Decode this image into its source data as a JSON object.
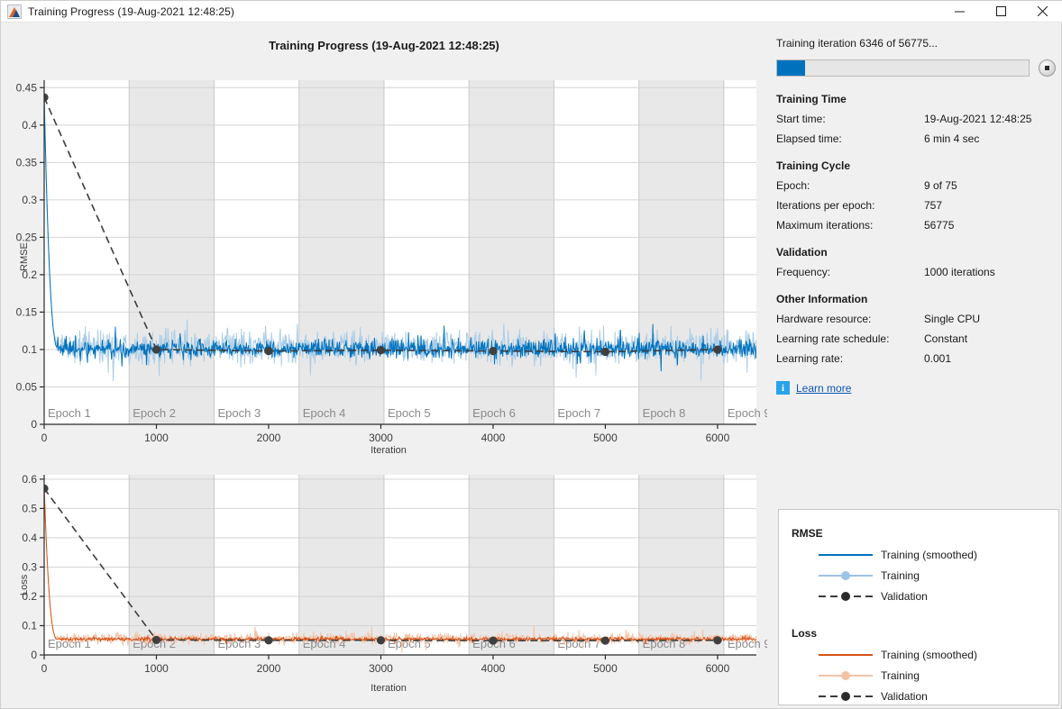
{
  "window": {
    "title": "Training Progress (19-Aug-2021 12:48:25)",
    "app_icon": "matlab-icon",
    "minimize_label": "Minimize",
    "maximize_label": "Maximize",
    "close_label": "Close"
  },
  "chart_title": "Training Progress (19-Aug-2021 12:48:25)",
  "status": {
    "text": "Training iteration 6346 of 56775...",
    "progress_percent": 11.2,
    "stop_button_label": "Stop",
    "progress_color": "#0072bd"
  },
  "sections": [
    {
      "heading": "Training Time",
      "rows": [
        {
          "key": "Start time:",
          "value": "19-Aug-2021 12:48:25"
        },
        {
          "key": "Elapsed time:",
          "value": "6 min 4 sec"
        }
      ]
    },
    {
      "heading": "Training Cycle",
      "rows": [
        {
          "key": "Epoch:",
          "value": "9 of 75"
        },
        {
          "key": "Iterations per epoch:",
          "value": "757"
        },
        {
          "key": "Maximum iterations:",
          "value": "56775"
        }
      ]
    },
    {
      "heading": "Validation",
      "rows": [
        {
          "key": "Frequency:",
          "value": "1000 iterations"
        }
      ]
    },
    {
      "heading": "Other Information",
      "rows": [
        {
          "key": "Hardware resource:",
          "value": "Single CPU"
        },
        {
          "key": "Learning rate schedule:",
          "value": "Constant"
        },
        {
          "key": "Learning rate:",
          "value": "0.001"
        }
      ]
    }
  ],
  "learn_more": {
    "label": "Learn more",
    "icon": "info-icon"
  },
  "legend": {
    "groups": [
      {
        "title": "RMSE",
        "items": [
          {
            "label": "Training (smoothed)",
            "style": "solid",
            "color": "#0072bd",
            "marker": false
          },
          {
            "label": "Training",
            "style": "solid",
            "color": "#9dc3e6",
            "marker": true
          },
          {
            "label": "Validation",
            "style": "dashed",
            "color": "#3c3c3c",
            "marker": true
          }
        ]
      },
      {
        "title": "Loss",
        "items": [
          {
            "label": "Training (smoothed)",
            "style": "solid",
            "color": "#d95319",
            "marker": false
          },
          {
            "label": "Training",
            "style": "solid",
            "color": "#f3c3a8",
            "marker": true
          },
          {
            "label": "Validation",
            "style": "dashed",
            "color": "#3c3c3c",
            "marker": true
          }
        ]
      }
    ]
  },
  "chart_data": [
    {
      "id": "rmse",
      "type": "line",
      "title": "Training Progress (19-Aug-2021 12:48:25)",
      "xlabel": "Iteration",
      "ylabel": "RMSE",
      "xlim": [
        0,
        6346
      ],
      "ylim": [
        0,
        0.46
      ],
      "xticks": [
        0,
        1000,
        2000,
        3000,
        4000,
        5000,
        6000
      ],
      "yticks": [
        0,
        0.05,
        0.1,
        0.15,
        0.2,
        0.25,
        0.3,
        0.35,
        0.4,
        0.45
      ],
      "grid": true,
      "epoch_bands": {
        "iterations_per_epoch": 757,
        "labels": [
          "Epoch 1",
          "Epoch 2",
          "Epoch 3",
          "Epoch 4",
          "Epoch 5",
          "Epoch 6",
          "Epoch 7",
          "Epoch 8",
          "Epoch 9"
        ],
        "shade_color": "#e8e8e8"
      },
      "series": [
        {
          "name": "Training",
          "color": "#a8cce8",
          "style": "solid",
          "noise_amplitude": 0.032,
          "start_value": 0.44,
          "plateau_value": 0.103,
          "decay_iterations": 130
        },
        {
          "name": "Training (smoothed)",
          "color": "#0072bd",
          "style": "solid",
          "noise_amplitude": 0.017,
          "start_value": 0.44,
          "plateau_value": 0.101,
          "decay_iterations": 130
        },
        {
          "name": "Validation",
          "color": "#3c3c3c",
          "style": "dashed",
          "x": [
            0,
            1000,
            2000,
            3000,
            4000,
            5000,
            6000
          ],
          "y": [
            0.437,
            0.1,
            0.098,
            0.099,
            0.098,
            0.097,
            0.1
          ]
        }
      ]
    },
    {
      "id": "loss",
      "type": "line",
      "xlabel": "Iteration",
      "ylabel": "Loss",
      "xlim": [
        0,
        6346
      ],
      "ylim": [
        0,
        0.615
      ],
      "xticks": [
        0,
        1000,
        2000,
        3000,
        4000,
        5000,
        6000
      ],
      "yticks": [
        0,
        0.1,
        0.2,
        0.3,
        0.4,
        0.5,
        0.6
      ],
      "grid": true,
      "epoch_bands": {
        "iterations_per_epoch": 757,
        "labels": [
          "Epoch 1",
          "Epoch 2",
          "Epoch 3",
          "Epoch 4",
          "Epoch 5",
          "Epoch 6",
          "Epoch 7",
          "Epoch 8",
          "Epoch 9"
        ],
        "shade_color": "#e8e8e8"
      },
      "series": [
        {
          "name": "Training",
          "color": "#f3c3a8",
          "style": "solid",
          "noise_amplitude": 0.026,
          "start_value": 0.575,
          "plateau_value": 0.056,
          "decay_iterations": 120
        },
        {
          "name": "Training (smoothed)",
          "color": "#d95319",
          "style": "solid",
          "noise_amplitude": 0.01,
          "start_value": 0.575,
          "plateau_value": 0.054,
          "decay_iterations": 120
        },
        {
          "name": "Validation",
          "color": "#3c3c3c",
          "style": "dashed",
          "x": [
            0,
            1000,
            2000,
            3000,
            4000,
            5000,
            6000
          ],
          "y": [
            0.568,
            0.051,
            0.05,
            0.05,
            0.049,
            0.049,
            0.05
          ]
        }
      ]
    }
  ]
}
